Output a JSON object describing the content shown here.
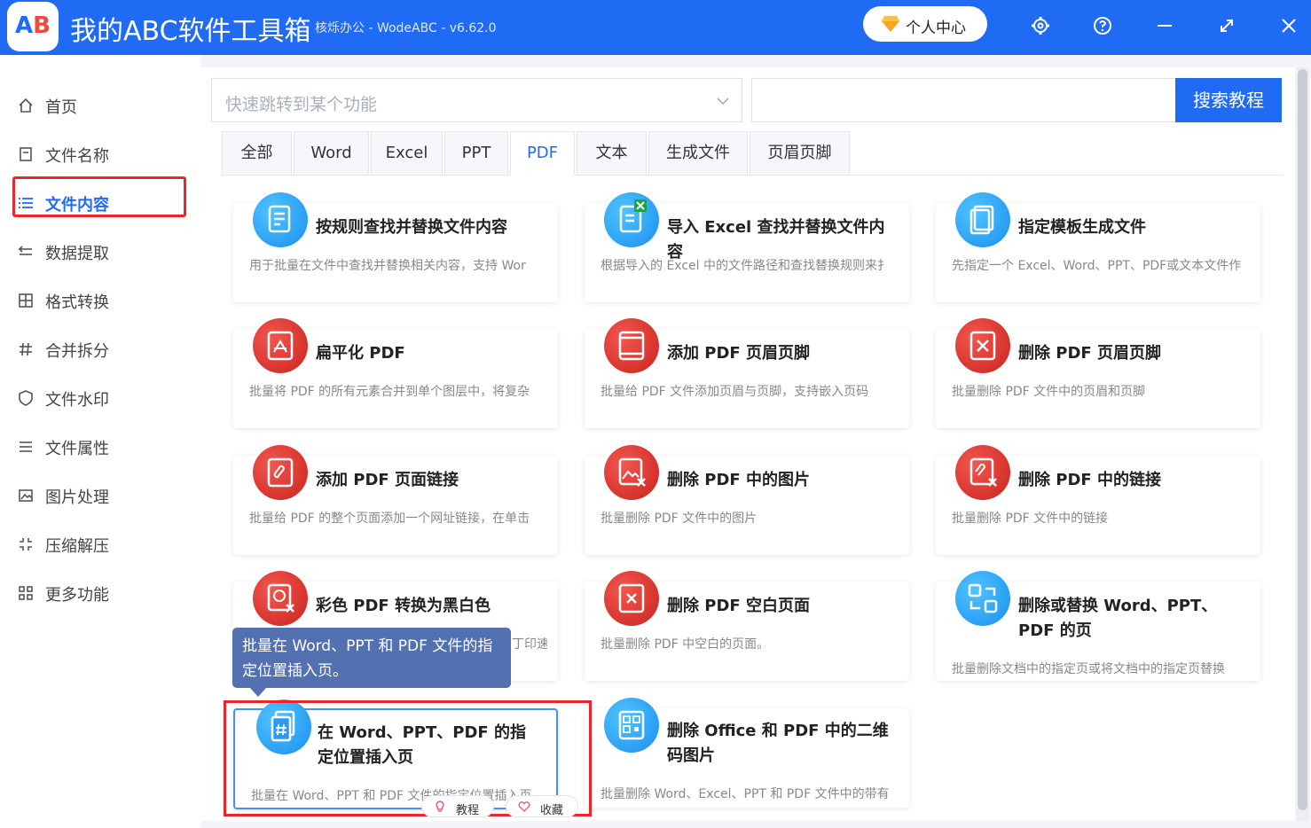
{
  "app": {
    "logo_text_a": "A",
    "logo_text_b": "B",
    "title": "我的ABC软件工具箱",
    "subtitle": "核烁办公 - WodeABC - v6.62.0",
    "user_center": "个人中心",
    "accent_color": "#1f6bf3"
  },
  "sidebar": {
    "items": [
      {
        "label": "首页",
        "icon": "home-icon"
      },
      {
        "label": "文件名称",
        "icon": "file-name-icon"
      },
      {
        "label": "文件内容",
        "icon": "list-icon"
      },
      {
        "label": "数据提取",
        "icon": "extract-icon"
      },
      {
        "label": "格式转换",
        "icon": "grid-icon"
      },
      {
        "label": "合并拆分",
        "icon": "hash-icon"
      },
      {
        "label": "文件水印",
        "icon": "shield-icon"
      },
      {
        "label": "文件属性",
        "icon": "lines-icon"
      },
      {
        "label": "图片处理",
        "icon": "image-icon"
      },
      {
        "label": "压缩解压",
        "icon": "compress-icon"
      },
      {
        "label": "更多功能",
        "icon": "apps-icon"
      }
    ],
    "active": "文件内容"
  },
  "toolbar": {
    "jump_placeholder": "快速跳转到某个功能",
    "search_value": "",
    "search_button": "搜索教程"
  },
  "tabs": [
    "全部",
    "Word",
    "Excel",
    "PPT",
    "PDF",
    "文本",
    "生成文件",
    "页眉页脚"
  ],
  "active_tab": "PDF",
  "cards": [
    {
      "title": "按规则查找并替换文件内容",
      "desc": "用于批量在文件中查找并替换相关内容，支持 Wor"
    },
    {
      "title": "导入 Excel 查找并替换文件内容",
      "desc": "根据导入的 Excel 中的文件路径和查找替换规则来扌"
    },
    {
      "title": "指定模板生成文件",
      "desc": "先指定一个 Excel、Word、PPT、PDF或文本文件作"
    },
    {
      "title": "扁平化 PDF",
      "desc": "批量将 PDF 的所有元素合并到单个图层中，将复杂"
    },
    {
      "title": "添加 PDF 页眉页脚",
      "desc": "批量给 PDF 文件添加页眉与页脚，支持嵌入页码"
    },
    {
      "title": "删除 PDF 页眉页脚",
      "desc": "批量删除 PDF 文件中的页眉和页脚"
    },
    {
      "title": "添加 PDF 页面链接",
      "desc": "批量给 PDF 的整个页面添加一个网址链接，在单击"
    },
    {
      "title": "删除 PDF 中的图片",
      "desc": "批量删除 PDF 文件中的图片"
    },
    {
      "title": "删除 PDF 中的链接",
      "desc": "批量删除 PDF 文件中的链接"
    },
    {
      "title": "彩色 PDF 转换为黑白色",
      "desc": "丁印速"
    },
    {
      "title": "删除 PDF 空白页面",
      "desc": "批量删除 PDF 中空白的页面。"
    },
    {
      "title": "删除或替换 Word、PPT、PDF 的页",
      "desc": "批量删除文档中的指定页或将文档中的指定页替换"
    },
    {
      "title": "在 Word、PPT、PDF 的指定位置插入页",
      "desc": "批量在 Word、PPT 和 PDF 文件的指定位置插入页"
    },
    {
      "title": "删除 Office 和 PDF 中的二维码图片",
      "desc": "批量删除 Word、Excel、PPT 和 PDF 文件中的带有"
    }
  ],
  "tooltip": "批量在 Word、PPT 和 PDF 文件的指定位置插入页。",
  "card_actions": {
    "tutorial": "教程",
    "favorite": "收藏"
  }
}
